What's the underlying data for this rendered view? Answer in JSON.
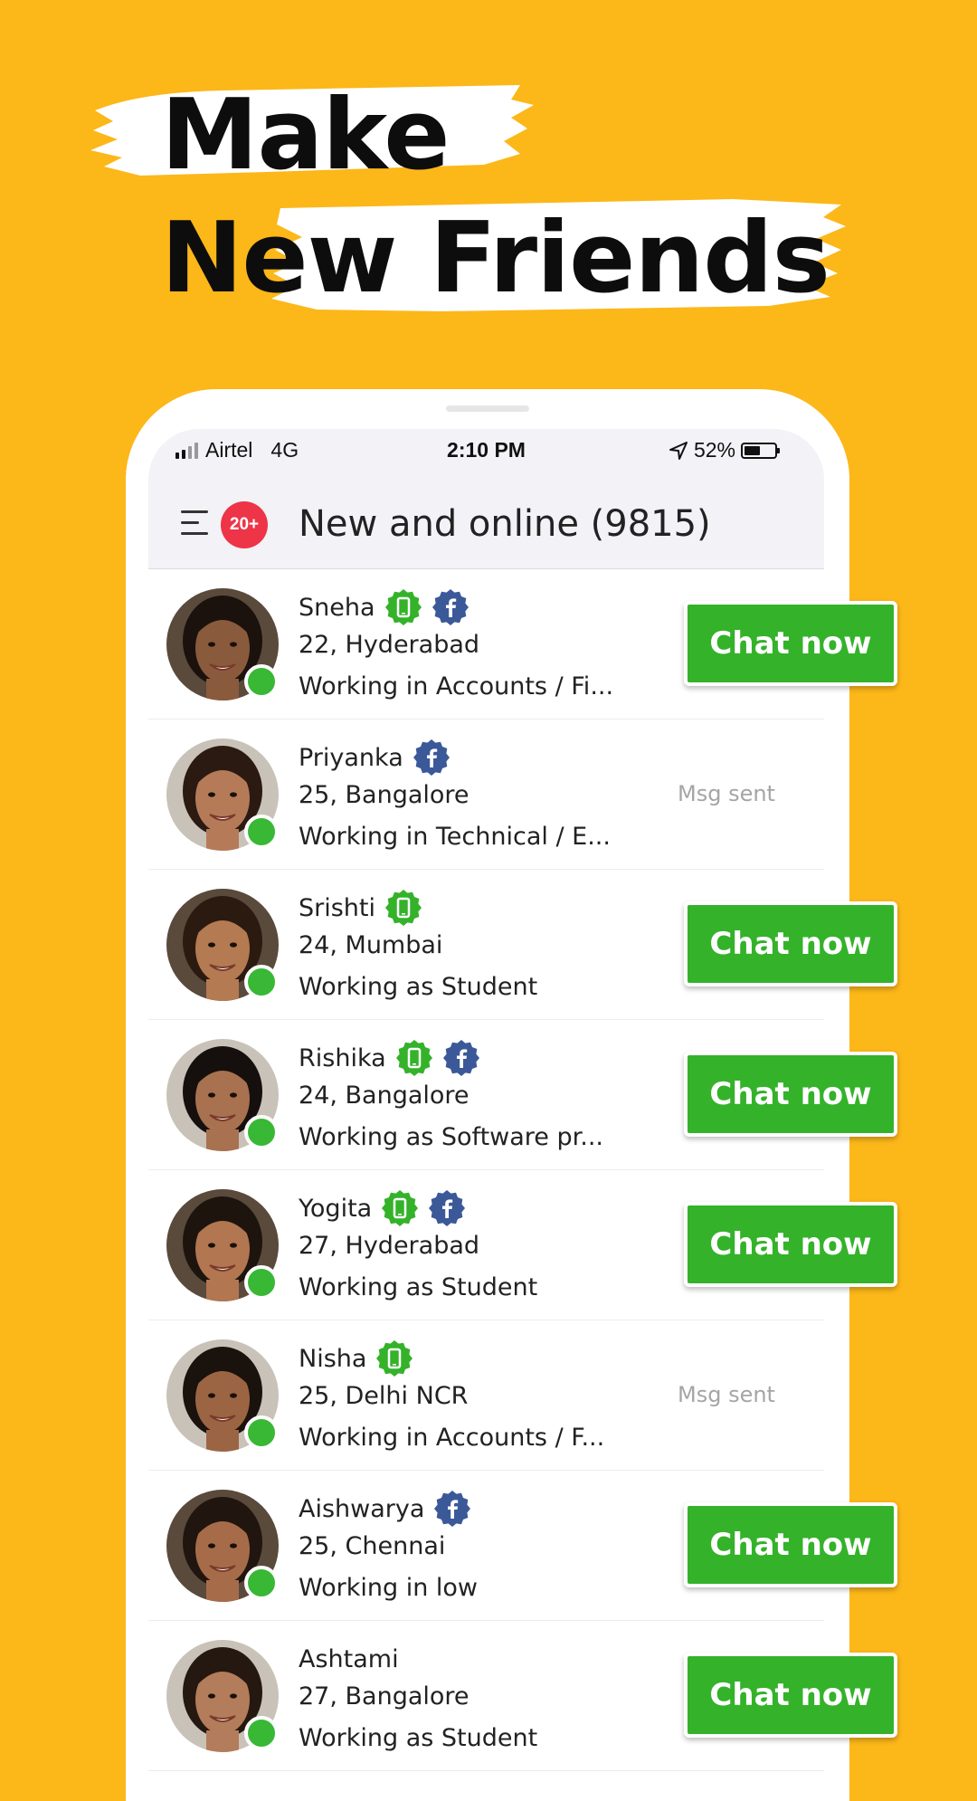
{
  "headline": {
    "line1": "Make",
    "line2": "New Friends"
  },
  "colors": {
    "background": "#FCB719",
    "accent_green": "#34B22A",
    "badge_red": "#EE3447",
    "facebook_blue": "#3B5998",
    "online_green": "#38B834"
  },
  "status_bar": {
    "carrier": "Airtel",
    "network": "4G",
    "time": "2:10 PM",
    "battery": "52%",
    "battery_level": 0.52,
    "location_icon": "location-arrow-icon"
  },
  "header": {
    "menu_icon": "hamburger-menu-icon",
    "notification_count": "20+",
    "title": "New and online (9815)"
  },
  "users": [
    {
      "name": "Sneha",
      "location": "22, Hyderabad",
      "work": "Working in Accounts / Fi...",
      "verified_phone": true,
      "facebook": true,
      "action": "Chat now",
      "online": true,
      "skin": "#8a5a3c",
      "hair": "#1b120d"
    },
    {
      "name": "Priyanka",
      "location": "25, Bangalore",
      "work": "Working in Technical / E...",
      "verified_phone": false,
      "facebook": true,
      "action": "Msg sent",
      "online": true,
      "skin": "#b57b59",
      "hair": "#2a1a12"
    },
    {
      "name": "Srishti",
      "location": "24, Mumbai",
      "work": "Working as Student",
      "verified_phone": true,
      "facebook": false,
      "action": "Chat now",
      "online": true,
      "skin": "#b47a52",
      "hair": "#2b1a10"
    },
    {
      "name": "Rishika",
      "location": "24, Bangalore",
      "work": "Working as Software pr...",
      "verified_phone": true,
      "facebook": true,
      "action": "Chat now",
      "online": true,
      "skin": "#a8714f",
      "hair": "#15100d"
    },
    {
      "name": "Yogita",
      "location": "27, Hyderabad",
      "work": "Working as Student",
      "verified_phone": true,
      "facebook": true,
      "action": "Chat now",
      "online": true,
      "skin": "#b27650",
      "hair": "#1d140e"
    },
    {
      "name": "Nisha",
      "location": "25, Delhi NCR",
      "work": "Working in Accounts / F...",
      "verified_phone": true,
      "facebook": false,
      "action": "Msg sent",
      "online": true,
      "skin": "#9b6544",
      "hair": "#1a120c"
    },
    {
      "name": "Aishwarya",
      "location": "25, Chennai",
      "work": "Working in low",
      "verified_phone": false,
      "facebook": true,
      "action": "Chat now",
      "online": true,
      "skin": "#a66c4a",
      "hair": "#20150f"
    },
    {
      "name": "Ashtami",
      "location": "27, Bangalore",
      "work": "Working as Student",
      "verified_phone": false,
      "facebook": false,
      "action": "Chat now",
      "online": true,
      "skin": "#b37c5a",
      "hair": "#241810"
    }
  ]
}
